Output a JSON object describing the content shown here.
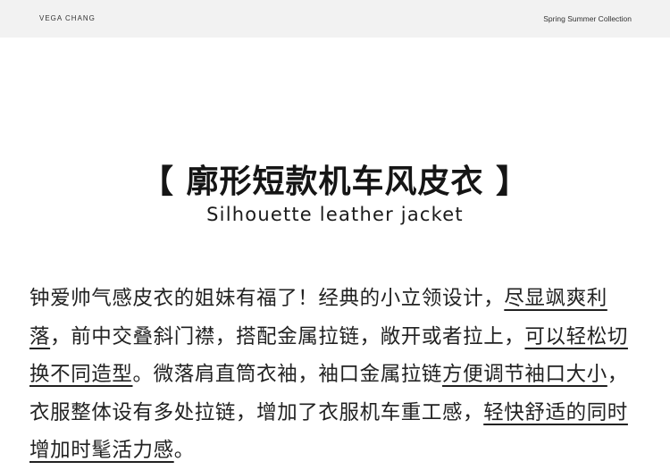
{
  "header": {
    "brand": "VEGA CHANG",
    "collection": "Spring Summer Collection"
  },
  "product": {
    "title": "【 廓形短款机车风皮衣 】",
    "subtitle": "Silhouette leather jacket"
  },
  "description": {
    "segments": [
      "钟爱帅气感皮衣的姐妹有福了！经典的小立领设计，",
      "尽显飒爽利落",
      "，前中交叠斜门襟，搭配金属拉链，敞开或者拉上，",
      "可以轻松切换不同造型",
      "。微落肩直筒衣袖，袖口金属拉链",
      "方便调节袖口大小",
      "，衣服整体设有多处拉链，增加了衣服机车重工感，",
      "轻快舒适的同时增加时髦活力感",
      "。"
    ]
  }
}
